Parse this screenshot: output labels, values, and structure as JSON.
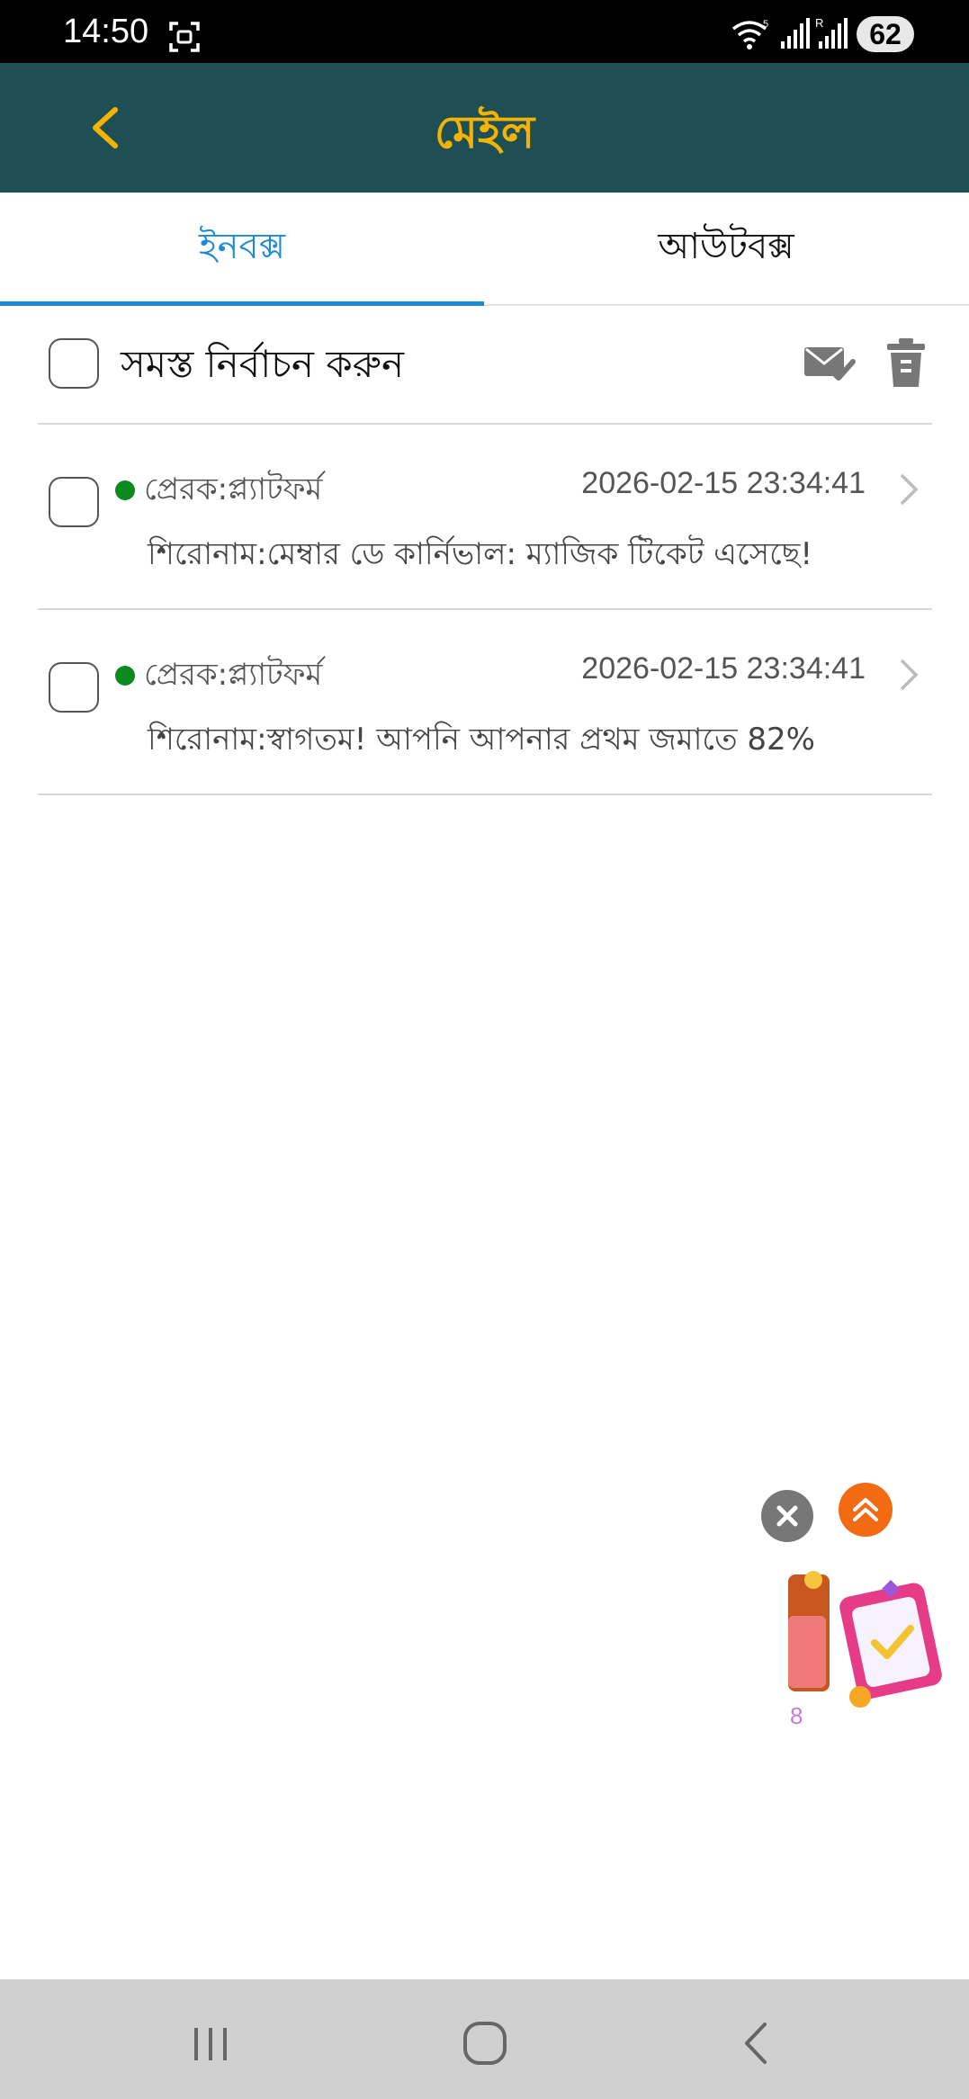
{
  "status_bar": {
    "time": "14:50",
    "battery": "62"
  },
  "header": {
    "title": "মেইল"
  },
  "tabs": [
    {
      "label": "ইনবক্স",
      "active": true
    },
    {
      "label": "আউটবক্স",
      "active": false
    }
  ],
  "select_all": {
    "label": "সমস্ত নির্বাচন করুন"
  },
  "mails": [
    {
      "sender": "প্রেরক:প্ল্যাটফর্ম",
      "time": "2026-02-15 23:34:41",
      "subject": "শিরোনাম:মেম্বার ডে কার্নিভাল: ম্যাজিক টিকেট এসেছে!",
      "unread": true
    },
    {
      "sender": "প্রেরক:প্ল্যাটফর্ম",
      "time": "2026-02-15 23:34:41",
      "subject": "শিরোনাম:স্বাগতম! আপনি আপনার প্রথম জমাতে 82%",
      "unread": true
    }
  ],
  "floating_widget": {
    "count": "8"
  },
  "colors": {
    "header_bg": "#1d4f55",
    "accent_title": "#f3b300",
    "tab_active": "#1e8ad6",
    "unread_dot": "#0d8a1f"
  }
}
